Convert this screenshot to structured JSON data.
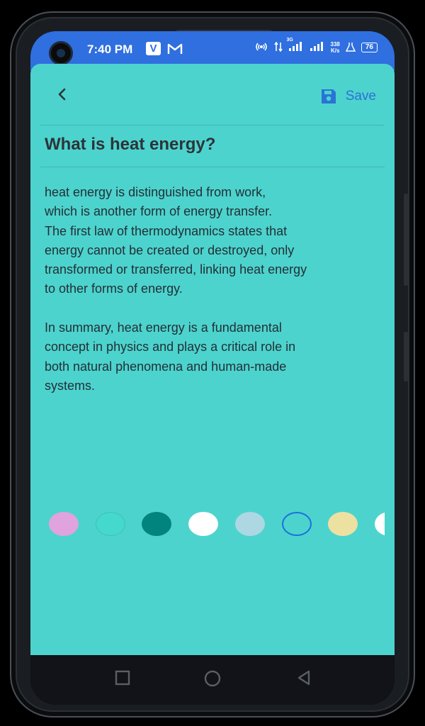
{
  "status_bar": {
    "time": "7:40 PM",
    "app_icon_v": "V",
    "app_icon_m": "M",
    "network_type": "3G",
    "rate_value": "338",
    "rate_unit": "K/s",
    "battery": "76"
  },
  "toolbar": {
    "back_icon": "chevron-left-icon",
    "save_label": "Save",
    "save_icon": "floppy-disk-icon"
  },
  "note": {
    "title": "What is heat energy?",
    "body": "heat energy is distinguished from work,\nwhich is another form of energy transfer.\nThe first law of thermodynamics states that\nenergy cannot be created or destroyed, only\ntransformed or transferred, linking heat energy\nto other forms of energy.\n\nIn summary, heat energy is a fundamental\nconcept in physics and plays a critical role in\nboth natural phenomena and human-made\nsystems."
  },
  "color_options": [
    {
      "name": "pink",
      "color": "#e0a3dd"
    },
    {
      "name": "turquoise",
      "color": "#45d8cc"
    },
    {
      "name": "teal",
      "color": "#02847e"
    },
    {
      "name": "white",
      "color": "#ffffff"
    },
    {
      "name": "light-blue",
      "color": "#acd7e3"
    },
    {
      "name": "aqua-selected",
      "color": "#4dd3cd",
      "selected": true
    },
    {
      "name": "khaki",
      "color": "#ede1a2"
    },
    {
      "name": "off-white",
      "color": "#ffffff"
    }
  ],
  "colors": {
    "status_bar": "#2f6fe0",
    "app_background": "#4dd3cd",
    "accent": "#2a73d6"
  }
}
